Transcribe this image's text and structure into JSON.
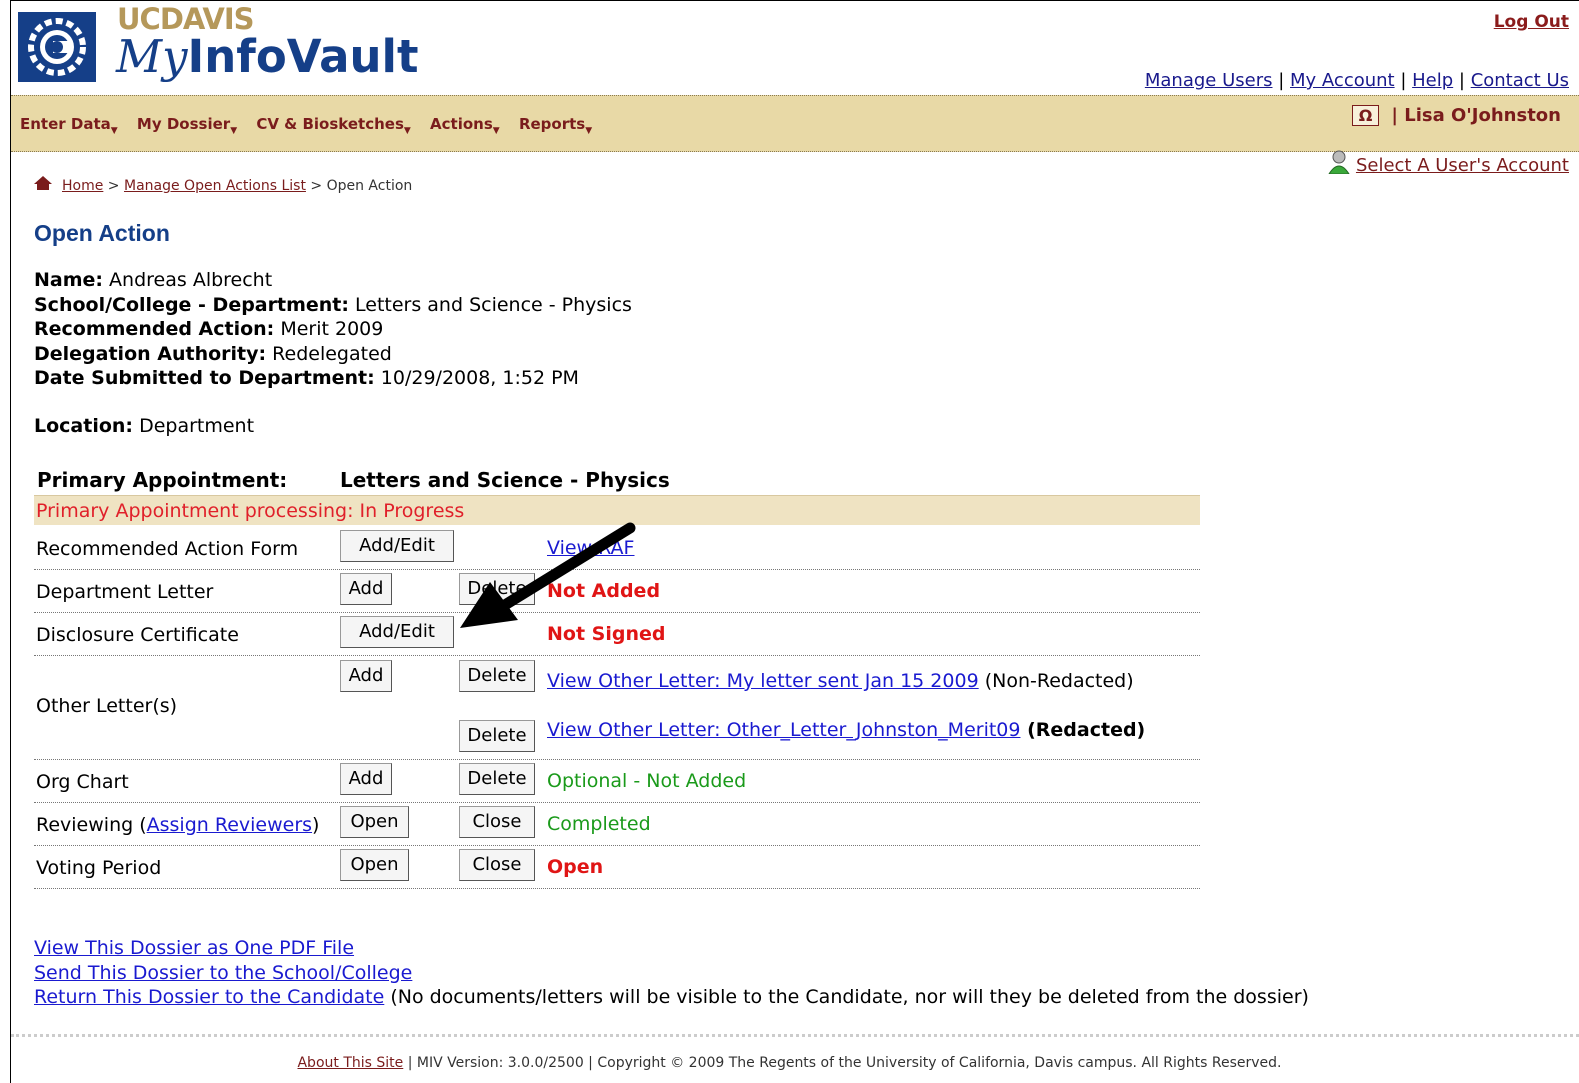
{
  "header": {
    "logo_ucdavis": "UCDAVIS",
    "logo_my": "My",
    "logo_infovault": "InfoVault",
    "logout": "Log Out",
    "top_links": [
      "Manage Users",
      "My Account",
      "Help",
      "Contact Us"
    ],
    "user_name": "Lisa O'Johnston",
    "omega_symbol": "Ω",
    "select_account": "Select A User's Account"
  },
  "menu": {
    "items": [
      "Enter Data",
      "My Dossier",
      "CV & Biosketches",
      "Actions",
      "Reports"
    ]
  },
  "breadcrumb": {
    "home": "Home",
    "sep1": " > ",
    "manage": "Manage Open Actions List",
    "sep2": " > ",
    "current": "Open Action"
  },
  "page_title": "Open Action",
  "info": {
    "name_label": "Name:",
    "name_value": " Andreas Albrecht",
    "school_label": "School/College - Department:",
    "school_value": " Letters and Science - Physics",
    "action_label": "Recommended Action:",
    "action_value": " Merit 2009",
    "delegation_label": "Delegation Authority:",
    "delegation_value": " Redelegated",
    "date_label": "Date Submitted to Department:",
    "date_value": " 10/29/2008, 1:52 PM",
    "location_label": "Location:",
    "location_value": " Department"
  },
  "table": {
    "primary_label": "Primary Appointment:",
    "primary_value": "Letters and Science - Physics",
    "banner": "Primary Appointment processing: In Progress",
    "raf_label": "Recommended Action Form",
    "raf_button": "Add/Edit",
    "raf_link": "View RAF",
    "dept_label": "Department Letter",
    "dept_add": "Add",
    "dept_delete": "Delete",
    "dept_status": "Not Added",
    "disc_label": "Disclosure Certificate",
    "disc_button": "Add/Edit",
    "disc_status": "Not Signed",
    "other_label": "Other Letter(s)",
    "other_add": "Add",
    "other_delete1": "Delete",
    "other_link1": "View Other Letter: My letter sent Jan 15 2009",
    "other_note1": " (Non-Redacted)",
    "other_delete2": "Delete",
    "other_link2": "View Other Letter: Other_Letter_Johnston_Merit09",
    "other_note2": " (Redacted)",
    "org_label": "Org Chart",
    "org_add": "Add",
    "org_delete": "Delete",
    "org_status": "Optional - Not Added",
    "review_label_a": "Reviewing (",
    "review_link": "Assign Reviewers",
    "review_label_b": ")",
    "review_open": "Open",
    "review_close": "Close",
    "review_status": "Completed",
    "voting_label": "Voting Period",
    "voting_open": "Open",
    "voting_close": "Close",
    "voting_status": "Open"
  },
  "bottom": {
    "pdf": "View This Dossier as One PDF File",
    "send": "Send This Dossier to the School/College",
    "return": "Return This Dossier to the Candidate",
    "return_note": " (No documents/letters will be visible to the Candidate, nor will they be deleted from the dossier)"
  },
  "footer": {
    "about": "About This Site",
    "rest": " | MIV Version: 3.0.0/2500 | Copyright © 2009 The Regents of the University of California, Davis campus. All Rights Reserved."
  },
  "colors": {
    "nav_bg": "#e8d9a6",
    "brand_blue": "#153f88",
    "brand_gold": "#b5985a",
    "alert_red": "#e01515",
    "ok_green": "#1a9a1a"
  }
}
